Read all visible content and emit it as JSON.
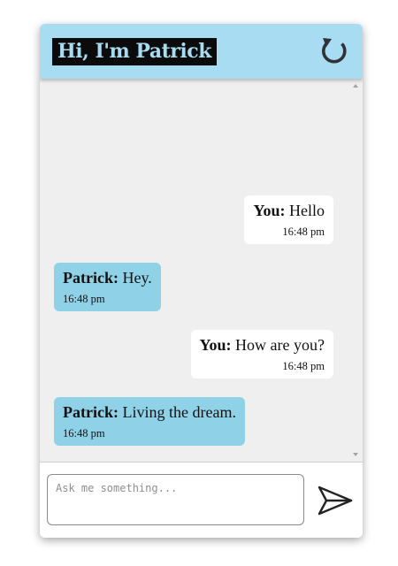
{
  "header": {
    "title": "Hi, I'm Patrick",
    "refresh_icon": "refresh-icon"
  },
  "messages": [
    {
      "sender": "You:",
      "text": " Hello",
      "time": "16:48 pm",
      "role": "user"
    },
    {
      "sender": "Patrick:",
      "text": " Hey.",
      "time": "16:48 pm",
      "role": "bot"
    },
    {
      "sender": "You:",
      "text": " How are you?",
      "time": "16:48 pm",
      "role": "user"
    },
    {
      "sender": "Patrick:",
      "text": " Living the dream.",
      "time": "16:48 pm",
      "role": "bot"
    }
  ],
  "input": {
    "placeholder": "Ask me something...",
    "value": "",
    "send_icon": "send-icon"
  },
  "colors": {
    "header_bg": "#a8dcf2",
    "bot_bubble": "#8fd2e8",
    "user_bubble": "#ffffff",
    "chat_bg": "#efefef"
  }
}
